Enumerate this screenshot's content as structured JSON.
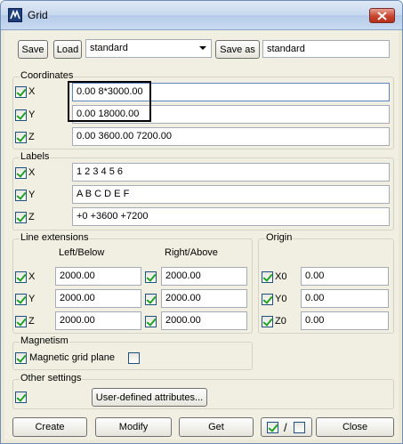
{
  "window": {
    "title": "Grid"
  },
  "toolbar": {
    "save_label": "Save",
    "load_label": "Load",
    "preset_select": "standard",
    "save_as_label": "Save as",
    "save_as_value": "standard"
  },
  "coordinates": {
    "label": "Coordinates",
    "x": {
      "axis": "X",
      "value": "0.00 8*3000.00",
      "checked": true
    },
    "y": {
      "axis": "Y",
      "value": "0.00 18000.00",
      "checked": true
    },
    "z": {
      "axis": "Z",
      "value": "0.00 3600.00 7200.00",
      "checked": true
    }
  },
  "labels": {
    "label": "Labels",
    "x": {
      "axis": "X",
      "value": "1 2 3 4 5 6",
      "checked": true
    },
    "y": {
      "axis": "Y",
      "value": "A B C D E F",
      "checked": true
    },
    "z": {
      "axis": "Z",
      "value": "+0 +3600 +7200",
      "checked": true
    }
  },
  "line_extensions": {
    "label": "Line extensions",
    "left_below_header": "Left/Below",
    "right_above_header": "Right/Above",
    "rows": [
      {
        "axis": "X",
        "left": "2000.00",
        "right": "2000.00"
      },
      {
        "axis": "Y",
        "left": "2000.00",
        "right": "2000.00"
      },
      {
        "axis": "Z",
        "left": "2000.00",
        "right": "2000.00"
      }
    ]
  },
  "origin": {
    "label": "Origin",
    "rows": [
      {
        "axis": "X0",
        "value": "0.00"
      },
      {
        "axis": "Y0",
        "value": "0.00"
      },
      {
        "axis": "Z0",
        "value": "0.00"
      }
    ]
  },
  "magnetism": {
    "label": "Magnetism",
    "checkbox_label": "Magnetic grid plane",
    "checked": true
  },
  "other_settings": {
    "label": "Other settings",
    "user_defined_label": "User-defined attributes..."
  },
  "footer": {
    "create_label": "Create",
    "modify_label": "Modify",
    "get_label": "Get",
    "toggle_label": "/",
    "close_label": "Close"
  }
}
